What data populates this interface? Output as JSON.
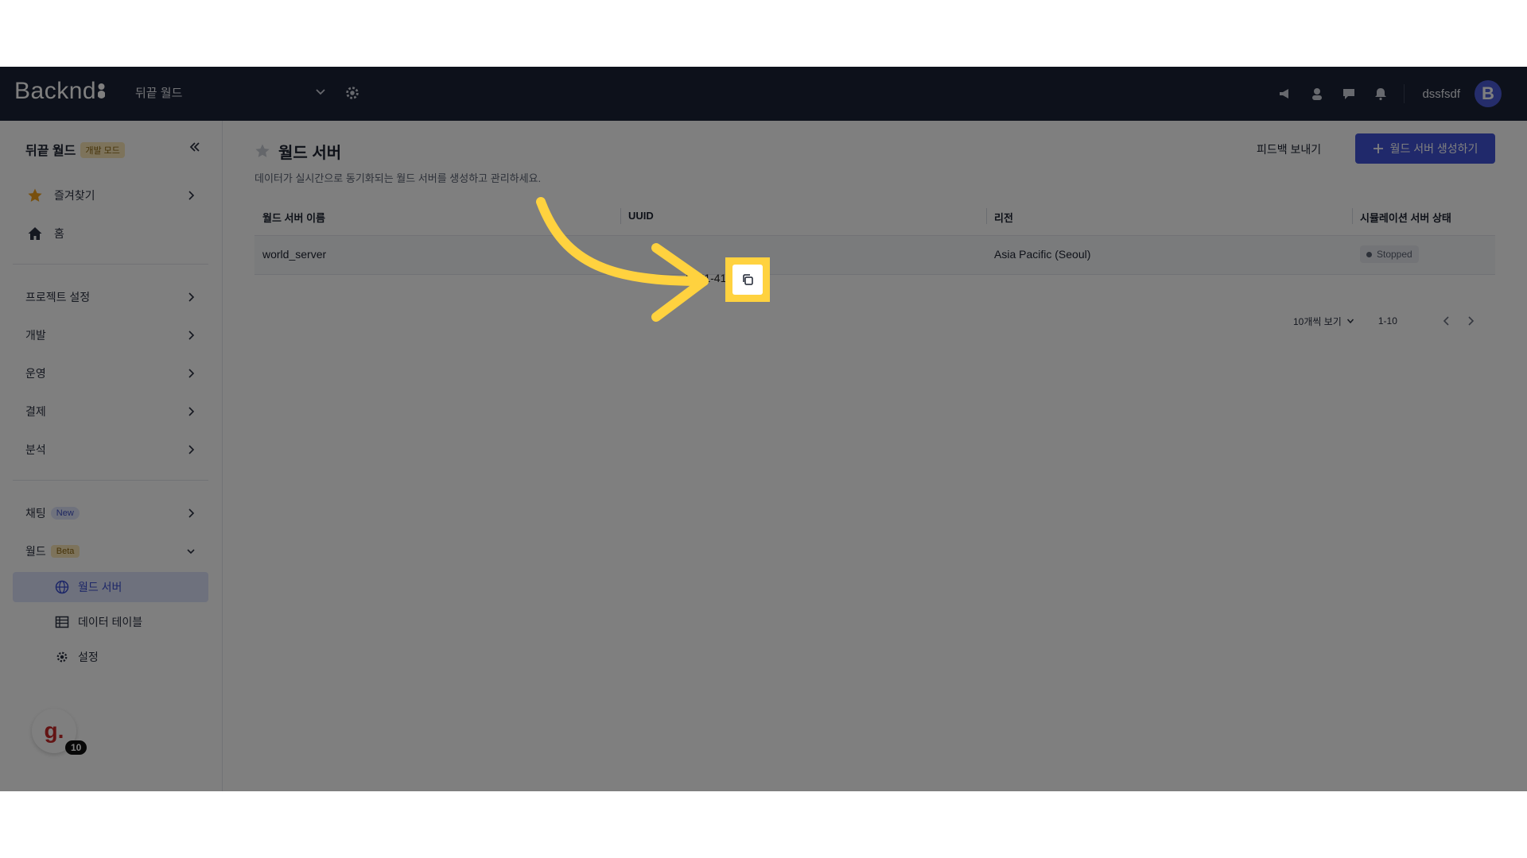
{
  "topbar": {
    "logo": "Backnd",
    "project_name": "뒤끝 월드",
    "username": "dssfsdf",
    "avatar_letter": "B",
    "icons": [
      "megaphone-icon",
      "support-agent-icon",
      "chat-icon",
      "bell-icon"
    ]
  },
  "sidebar": {
    "project_title": "뒤끝 월드",
    "mode_badge": "개발 모드",
    "items": [
      {
        "label": "즐겨찾기",
        "icon": "star-icon"
      },
      {
        "label": "홈",
        "icon": "home-icon"
      },
      {
        "label": "프로젝트 설정"
      },
      {
        "label": "개발"
      },
      {
        "label": "운영"
      },
      {
        "label": "결제"
      },
      {
        "label": "분석"
      },
      {
        "label": "채팅",
        "badge": "New"
      },
      {
        "label": "월드",
        "badge": "Beta"
      }
    ],
    "sub_items": [
      {
        "label": "월드 서버",
        "icon": "globe-icon",
        "active": true
      },
      {
        "label": "데이터 테이블",
        "icon": "table-icon"
      },
      {
        "label": "설정",
        "icon": "gear-icon"
      }
    ],
    "assistant_letter": "g.",
    "assistant_count": "10"
  },
  "main": {
    "title": "월드 서버",
    "description": "데이터가 실시간으로 동기화되는 월드 서버를 생성하고 관리하세요.",
    "feedback_label": "피드백 보내기",
    "create_label": "월드 서버 생성하기",
    "table": {
      "columns": [
        "월드 서버 이름",
        "UUID",
        "리전",
        "시뮬레이션 서버 상태"
      ],
      "rows": [
        {
          "name": "world_server",
          "uuid": "3e51-41",
          "region": "Asia Pacific (Seoul)",
          "status": "Stopped"
        }
      ]
    },
    "pager": {
      "per_page": "10개씩 보기",
      "range": "1-10"
    }
  },
  "colors": {
    "topbar": "#1a2236",
    "accent": "#4053d6",
    "highlight": "#ffd23f"
  }
}
